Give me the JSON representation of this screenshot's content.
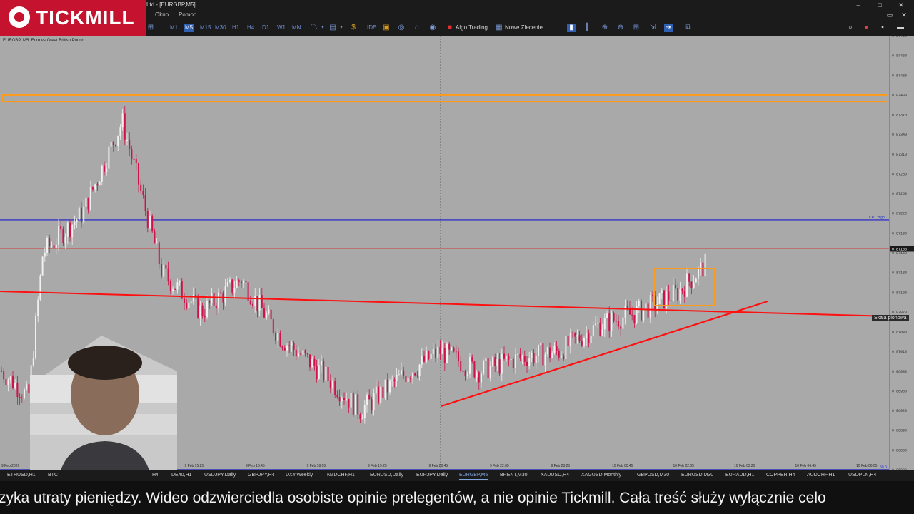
{
  "brand": {
    "name": "TICKMILL"
  },
  "window": {
    "title": "Ltd - [EURGBP,M5]"
  },
  "menu": {
    "items": [
      "Okno",
      "Pomoc"
    ]
  },
  "toolbar": {
    "timeframes": [
      "M1",
      "M5",
      "M15",
      "M30",
      "H1",
      "H4",
      "D1",
      "W1",
      "MN"
    ],
    "active_timeframe": "M5",
    "ide_label": "IDE",
    "algo_trading_label": "Algo Trading",
    "new_order_label": "Nowe Zlecenie"
  },
  "chart": {
    "symbol_label": "EURGBP, M5:  Euro vs Great British Pound",
    "price_ticks": [
      "0.87490",
      "0.87460",
      "0.87430",
      "0.87400",
      "0.87370",
      "0.87340",
      "0.87310",
      "0.87280",
      "0.87250",
      "0.87220",
      "0.87190",
      "0.87160",
      "0.87130",
      "0.87100",
      "0.87070",
      "0.87040",
      "0.87010",
      "0.86980",
      "0.86950",
      "0.86920",
      "0.86890",
      "0.86860",
      "0.86830"
    ],
    "current_price": "0.87166",
    "level_label": "CRT High",
    "bottom_label": "50.0",
    "time_ticks": [
      "9 Feb 2026",
      "9 Feb 12:45",
      "9 Feb 14:05",
      "9 Feb 15:25",
      "9 Feb 16:45",
      "9 Feb 18:05",
      "9 Feb 19:25",
      "9 Feb 20:45",
      "9 Feb 22:05",
      "9 Feb 23:25",
      "10 Feb 00:45",
      "10 Feb 02:05",
      "10 Feb 03:25",
      "10 Feb 04:45",
      "10 Feb 06:05",
      "10 Feb 07:25",
      "10 Feb 08:45",
      "10 Feb 10:05",
      "10 Feb 11:25"
    ],
    "tooltip": "Skala pionowa"
  },
  "chart_data": {
    "type": "candlestick",
    "symbol": "EURGBP",
    "timeframe": "M5",
    "x": [
      "9 Feb 12:45",
      "9 Feb 14:05",
      "9 Feb 15:25",
      "9 Feb 16:45",
      "9 Feb 18:05",
      "9 Feb 19:25",
      "9 Feb 20:45",
      "9 Feb 22:05",
      "9 Feb 23:25",
      "10 Feb 00:45",
      "10 Feb 02:05",
      "10 Feb 03:25",
      "10 Feb 04:45",
      "10 Feb 06:05",
      "10 Feb 07:25",
      "10 Feb 08:45",
      "10 Feb 10:05",
      "10 Feb 11:25"
    ],
    "y": [
      0.8716,
      0.8722,
      0.8736,
      0.8713,
      0.8707,
      0.8712,
      0.8703,
      0.8698,
      0.8692,
      0.8697,
      0.8701,
      0.8698,
      0.87,
      0.8701,
      0.8705,
      0.8707,
      0.871,
      0.8716
    ],
    "ylim": [
      0.8683,
      0.8749
    ],
    "horizontal_levels": [
      0.874,
      0.8739,
      0.8721,
      0.87166,
      0.8683
    ],
    "current_price": 0.87166,
    "grid": false
  },
  "colors": {
    "chart_bg": "#a9a9a9",
    "bull_candle": "#f0f0f0",
    "bear_candle": "#d0124a",
    "trendline": "#ff1010",
    "resistance": "#ff9a1a",
    "level_line": "#1a1acc",
    "brand_red": "#c4122f"
  },
  "tabs": [
    "ETHUSD,H1",
    "BTC",
    "H4",
    "DE40,H1",
    "USDJPY,Daily",
    "GBPJPY,H4",
    "DXY,Weekly",
    "NZDCHF,H1",
    "EURUSD,Daily",
    "EURJPY,Daily",
    "EURGBP,M5",
    "BRENT,M30",
    "XAUUSD,H4",
    "XAGUSD,Monthly",
    "GBPUSD,M30",
    "EURUSD,M30",
    "EURAUD,H1",
    "COPPER,H4",
    "AUDCHF,H1",
    "USDPLN,H4"
  ],
  "active_tab": "EURGBP,M5",
  "subtitle": {
    "text": "zyka utraty pieniędzy. Wideo odzwierciedla osobiste opinie prelegentów, a nie opinie Tickmill. Cała treść służy wyłącznie celo"
  }
}
